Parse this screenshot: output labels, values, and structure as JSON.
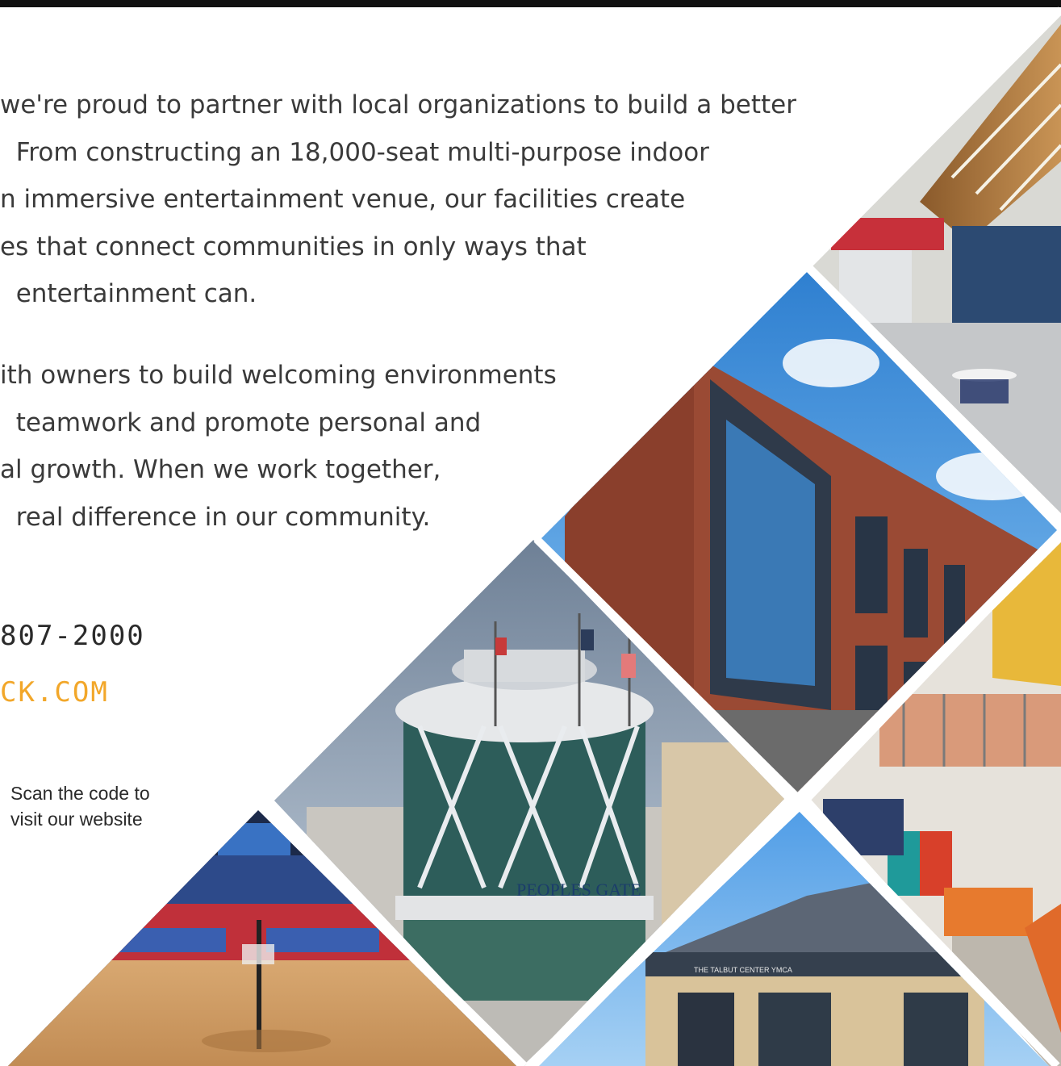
{
  "paragraphs": {
    "intro": [
      "we're proud to partner with local organizations to build a better",
      "  From constructing an 18,000-seat multi-purpose indoor",
      "n immersive entertainment venue, our facilities create",
      "es that connect communities in only ways that",
      "  entertainment can."
    ],
    "second": [
      "ith owners to build welcoming environments",
      "  teamwork and promote personal and",
      "al growth. When we work together,",
      "  real difference in our community."
    ]
  },
  "contact": {
    "phone": "807-2000",
    "website": "CK.COM"
  },
  "qr": {
    "caption": "Scan the code to visit our website"
  },
  "photos": [
    {
      "name": "arena-interior-photo",
      "sign_text": "",
      "subject": "basketball arena"
    },
    {
      "name": "peoples-gate-photo",
      "sign_text": "PEOPLES GATE",
      "subject": "entertainment venue tower"
    },
    {
      "name": "brick-building-photo",
      "sign_text": "",
      "subject": "brick and glass facility"
    },
    {
      "name": "lobby-interior-photo",
      "sign_text": "",
      "subject": "atrium with wood ceiling"
    },
    {
      "name": "staircase-photo",
      "sign_text": "",
      "subject": "stairway and lounge"
    },
    {
      "name": "ymca-photo",
      "sign_text": "THE TALBUT CENTER YMCA",
      "subject": "community center exterior"
    },
    {
      "name": "yellow-stair-photo",
      "sign_text": "",
      "subject": "yellow stair detail"
    }
  ],
  "colors": {
    "accent": "#f2a72a",
    "text": "#3a3a3a",
    "topbar": "#111111"
  }
}
